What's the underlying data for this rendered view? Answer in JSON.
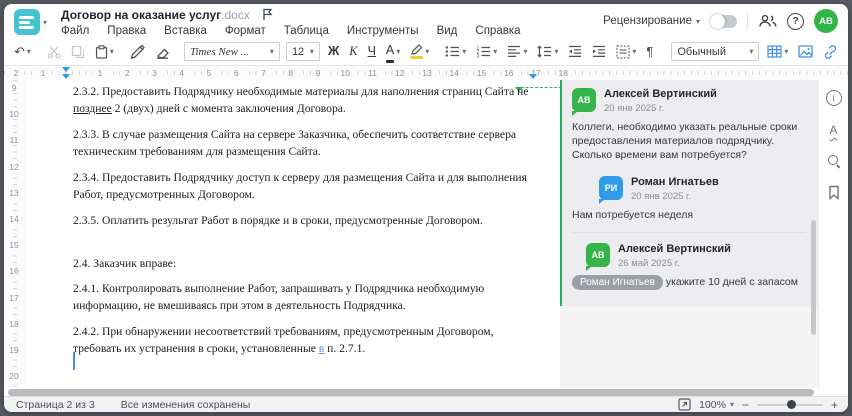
{
  "titlebar": {
    "doc_title": "Договор на оказание услуг",
    "doc_ext": ".docx",
    "review_label": "Рецензирование",
    "avatar_initials": "АВ"
  },
  "menu": {
    "items": [
      "Файл",
      "Правка",
      "Вставка",
      "Формат",
      "Таблица",
      "Инструменты",
      "Вид",
      "Справка"
    ]
  },
  "toolbar": {
    "font_name": "Times New ...",
    "font_size": "12",
    "bold_label": "Ж",
    "italic_label": "К",
    "underline_label": "Ч",
    "font_color_label": "А",
    "style_name": "Обычный"
  },
  "icons": {
    "caret": "▾",
    "undo": "↶",
    "pilcrow": "¶",
    "more": "···",
    "help": "?",
    "minus": "−",
    "plus": "+",
    "info": "i",
    "spellcheck_letter": "А"
  },
  "ruler": {
    "h_pre": [
      "2",
      "1"
    ],
    "h_numbers": [
      "1",
      "2",
      "3",
      "4",
      "5",
      "6",
      "7",
      "8",
      "9",
      "10",
      "11",
      "12",
      "13",
      "14",
      "15",
      "16",
      "17",
      "18"
    ],
    "v_numbers": [
      "9",
      "10",
      "11",
      "12",
      "13",
      "14",
      "15",
      "16",
      "17",
      "18",
      "19",
      "20"
    ]
  },
  "document": {
    "p232": {
      "pre": "2.3.2. Предоставить Подрядчику необходимые материалы для наполнения страниц Сайта не ",
      "ins": "позднее",
      "post": " 2 (двух) дней с момента заключения Договора."
    },
    "p233": {
      "text": "2.3.3. В случае размещения Сайта на сервере Заказчика, обеспечить соответствие сервера техническим требованиям для размещения Сайта."
    },
    "p234": {
      "text": "2.3.4. Предоставить Подрядчику доступ к серверу для размещения Сайта и для выполнения Работ, предусмотренных Договором."
    },
    "p235": {
      "text": "2.3.5. Оплатить результат Работ в порядке и в сроки, предусмотренные Договором."
    },
    "p24": {
      "text": "2.4. Заказчик вправе:"
    },
    "p241": {
      "text": "2.4.1. Контролировать выполнение Работ, запрашивать у Подрядчика необходимую информацию, не вмешиваясь при этом в деятельность Подрядчика."
    },
    "p242": {
      "pre": "2.4.2. При обнаружении несоответствий требованиям, предусмотренным Договором, требовать их устранения в сроки, установленные ",
      "ins": "в",
      "post": " п. 2.7.1."
    }
  },
  "comments": {
    "thread": [
      {
        "initials": "АВ",
        "name": "Алексей Вертинский",
        "date": "20 янв 2025 г.",
        "text": "Коллеги, необходимо указать реальные сроки предоставления материалов подрядчику. Сколько времени вам потребуется?"
      },
      {
        "initials": "РИ",
        "name": "Роман Игнатьев",
        "date": "20 янв 2025 г.",
        "text": "Нам потребуется неделя"
      },
      {
        "initials": "АВ",
        "name": "Алексей Вертинский",
        "date": "26 май 2025 г.",
        "mention": "Роман Игнатьев",
        "text": " укажите 10 дней с запасом"
      }
    ]
  },
  "statusbar": {
    "page_label": "Страница 2 из 3",
    "saved_label": "Все изменения сохранены",
    "zoom_value": "100%"
  },
  "colors": {
    "brand_teal": "#46c3d0",
    "avatar_green": "#35b44a",
    "avatar_blue": "#2e9ceb",
    "comment_anchor_green": "#27ae60",
    "blue_icon": "#3e8ee4",
    "ruler_marker_blue": "#2e9cd6"
  }
}
